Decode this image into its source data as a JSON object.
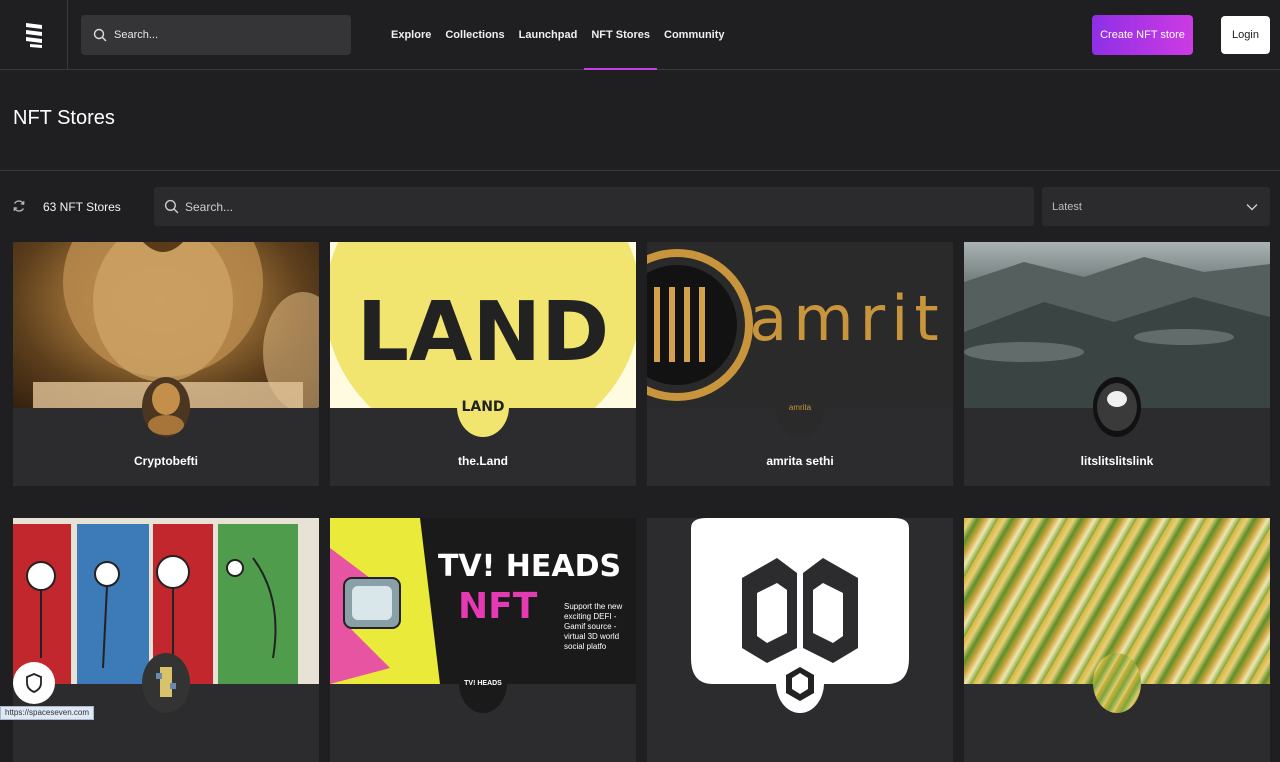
{
  "header": {
    "search_placeholder": "Search...",
    "nav": [
      {
        "label": "Explore"
      },
      {
        "label": "Collections"
      },
      {
        "label": "Launchpad"
      },
      {
        "label": "NFT Stores",
        "active": true
      },
      {
        "label": "Community"
      }
    ],
    "create_label": "Create NFT store",
    "login_label": "Login"
  },
  "page": {
    "title": "NFT Stores",
    "count_label": "63 NFT Stores",
    "search_placeholder": "Search...",
    "sort_value": "Latest"
  },
  "stores": [
    {
      "name": "Cryptobefti"
    },
    {
      "name": "the.Land",
      "banner_text": "LAND",
      "avatar_text": "LAND"
    },
    {
      "name": "amrita sethi",
      "banner_text": "amrit",
      "avatar_text": "amrita"
    },
    {
      "name": "litslitslitslink"
    },
    {
      "name": ""
    },
    {
      "name": "",
      "banner_text_1": "TV! HEADS",
      "banner_text_2": "NFT",
      "banner_text_3": "Support the new exciting DEFI - Gamif source - virtual 3D world social platfo",
      "avatar_text": "TV! HEADS"
    },
    {
      "name": ""
    },
    {
      "name": ""
    }
  ],
  "status_bar": {
    "url": "https://spaceseven.com"
  },
  "colors": {
    "accent": "#c63fe0",
    "background": "#1f1e20",
    "card": "#2c2b2e",
    "land_yellow": "#f1e46f"
  }
}
